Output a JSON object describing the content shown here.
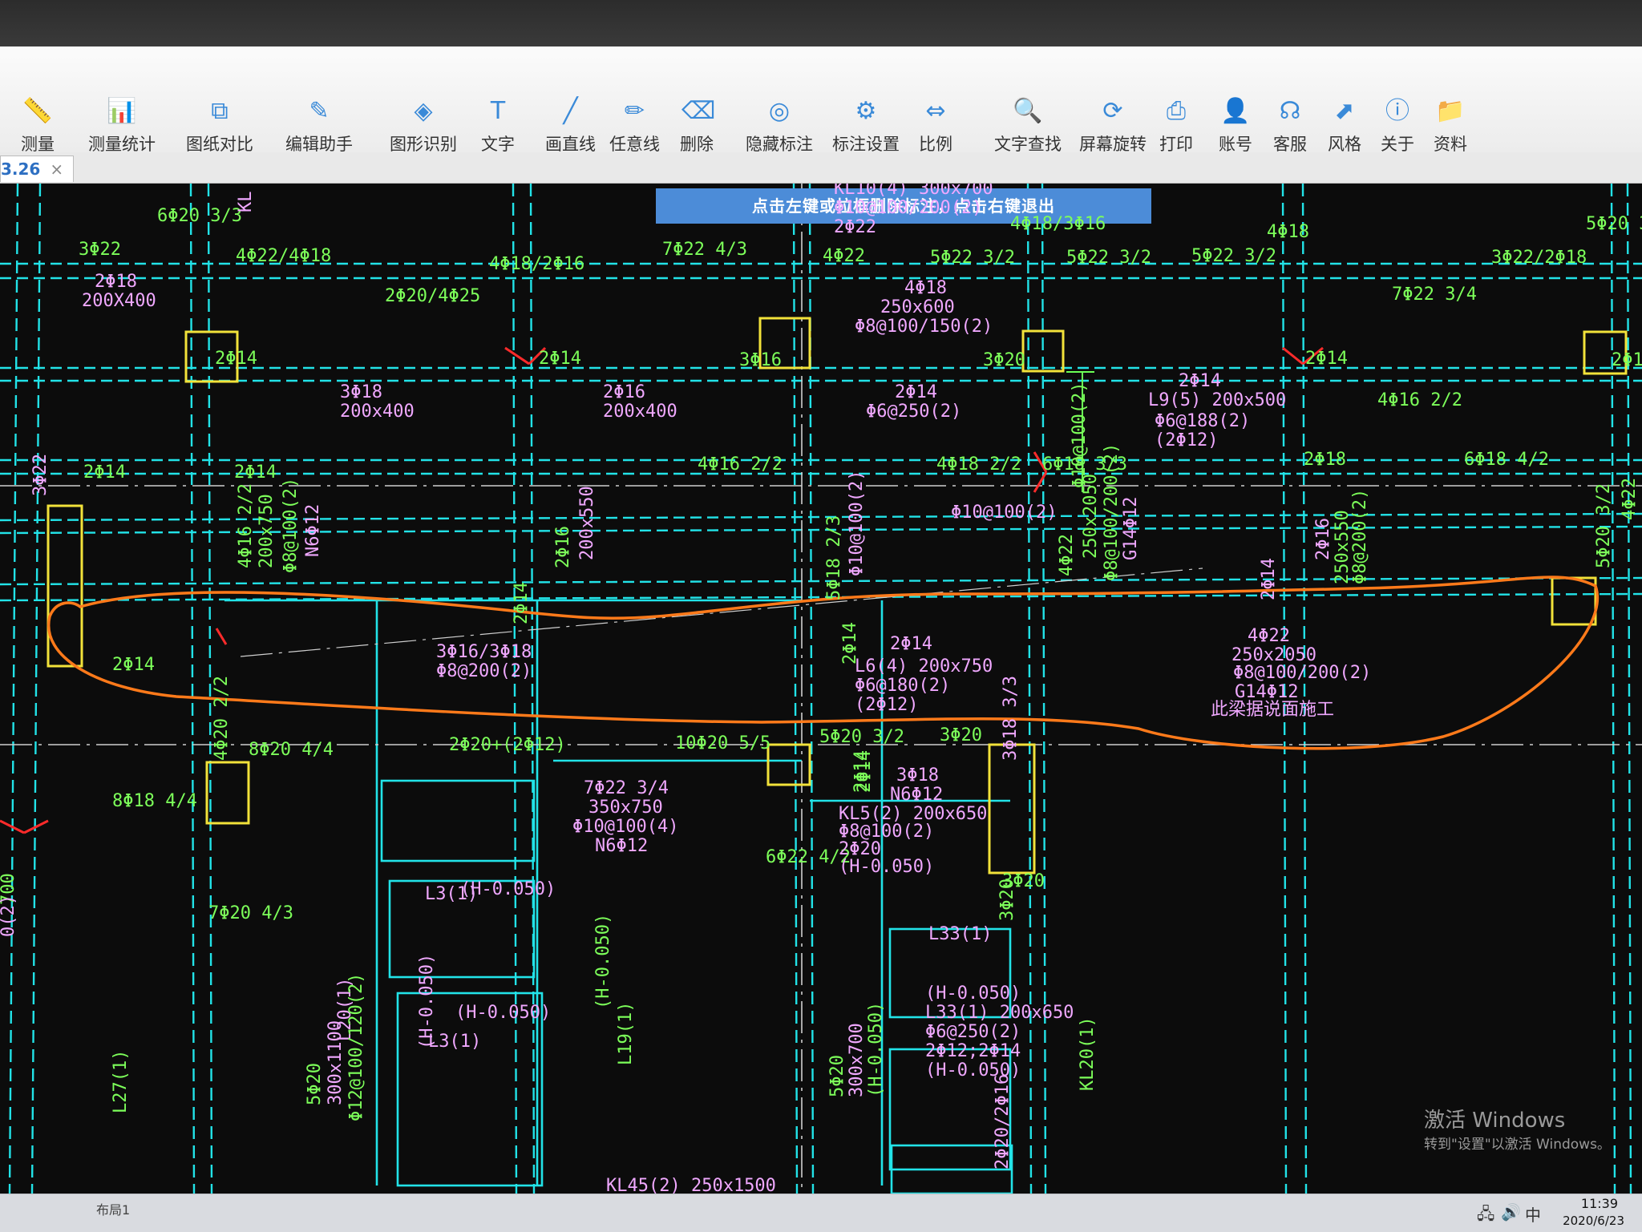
{
  "toolbar": {
    "items": [
      {
        "label": "测量",
        "icon": "ruler-icon",
        "glyph": "📏"
      },
      {
        "label": "测量统计",
        "icon": "measure-stats-icon",
        "glyph": "📊"
      },
      {
        "label": "图纸对比",
        "icon": "compare-drawings-icon",
        "glyph": "⧉"
      },
      {
        "label": "编辑助手",
        "icon": "edit-assistant-icon",
        "glyph": "✎"
      },
      {
        "label": "图形识别",
        "icon": "shape-recognition-icon",
        "glyph": "◈"
      },
      {
        "label": "文字",
        "icon": "text-icon",
        "glyph": "T"
      },
      {
        "label": "画直线",
        "icon": "line-icon",
        "glyph": "╱"
      },
      {
        "label": "任意线",
        "icon": "freehand-icon",
        "glyph": "✏"
      },
      {
        "label": "删除",
        "icon": "eraser-icon",
        "glyph": "⌫"
      },
      {
        "label": "隐藏标注",
        "icon": "hide-annotation-icon",
        "glyph": "◎"
      },
      {
        "label": "标注设置",
        "icon": "annotation-settings-icon",
        "glyph": "⚙"
      },
      {
        "label": "比例",
        "icon": "scale-icon",
        "glyph": "⇔"
      },
      {
        "label": "文字查找",
        "icon": "text-search-icon",
        "glyph": "🔍"
      },
      {
        "label": "屏幕旋转",
        "icon": "rotate-screen-icon",
        "glyph": "⟳"
      },
      {
        "label": "打印",
        "icon": "printer-icon",
        "glyph": "⎙"
      },
      {
        "label": "账号",
        "icon": "user-icon",
        "glyph": "👤"
      },
      {
        "label": "客服",
        "icon": "headset-icon",
        "glyph": "☊"
      },
      {
        "label": "风格",
        "icon": "style-icon",
        "glyph": "⬈"
      },
      {
        "label": "关于",
        "icon": "info-icon",
        "glyph": "ⓘ"
      },
      {
        "label": "资料",
        "icon": "documents-icon",
        "glyph": "📁"
      }
    ]
  },
  "file_tab": {
    "label": "3.26",
    "close": "×"
  },
  "canvas": {
    "hint": "点击左键或拉框删除标注，点击右键退出",
    "green_labels": [
      "3Φ22",
      "6Φ20 3/3",
      "4Φ22/4Φ18",
      "2Φ20/4Φ25",
      "4Φ18/2Φ16",
      "7Φ22 4/3",
      "5Φ22 3/2",
      "4Φ22",
      "5Φ22 3/2",
      "5Φ22 3/2",
      "4Φ18/3Φ16",
      "4Φ18",
      "3Φ22/2Φ18",
      "5Φ20 3/2",
      "7Φ22 3/4",
      "2Φ14",
      "2Φ14",
      "3Φ16",
      "3Φ20",
      "2Φ14",
      "2Φ14",
      "4Φ16 2/2",
      "2Φ14",
      "2Φ14",
      "4Φ16 2/2",
      "4Φ18 2/2",
      "6Φ18 3/3",
      "2Φ18",
      "6Φ18 4/2",
      "2Φ14",
      "8Φ20 4/4",
      "2Φ20+(2Φ12)",
      "10Φ20 5/5",
      "5Φ20 3/2",
      "3Φ20",
      "8Φ18 4/4",
      "6Φ22 4/2",
      "7Φ20 4/3",
      "3Φ20"
    ],
    "pink_labels": [
      "KL10(4) 300x700",
      "Φ10@100/200(2)",
      "2Φ22",
      "2Φ18",
      "200X400",
      "4Φ18",
      "250x600",
      "Φ8@100/150(2)",
      "3Φ18",
      "200x400",
      "2Φ16",
      "200x400",
      "2Φ14",
      "Φ6@250(2)",
      "Φ10@100(2)",
      "2Φ14",
      "L9(5) 200x500",
      "Φ6@188(2)",
      "(2Φ12)",
      "3Φ16/3Φ18",
      "Φ8@200(2)",
      "2Φ14",
      "L6(4) 200x750",
      "Φ6@180(2)",
      "(2Φ12)",
      "4Φ22",
      "250x2050",
      "Φ8@100/200(2)",
      "G14Φ12",
      "此梁据说面施工",
      "7Φ22 3/4",
      "350x750",
      "Φ10@100(4)",
      "N6Φ12",
      "3Φ18",
      "N6Φ12",
      "KL5(2) 200x650",
      "Φ8@100(2)",
      "2Φ20",
      "(H-0.050)",
      "L3(1)",
      "(H-0.050)",
      "(H-0.050)",
      "L3(1)",
      "L33(1)",
      "(H-0.050)",
      "L33(1) 200x650",
      "Φ6@250(2)",
      "2Φ12;2Φ14",
      "(H-0.050)",
      "KL45(2) 250x1500"
    ],
    "vertical_labels": [
      "KL",
      "200x750",
      "Φ8@100(2)",
      "N6Φ12",
      "250x2050",
      "Φ8@100/200(2)",
      "G14Φ12",
      "4Φ16 2/2",
      "2Φ16",
      "200x550",
      "2Φ14",
      "5Φ18 2/3",
      "Φ10@100(2)",
      "Φ10@100(2)",
      "4Φ22",
      "2Φ16",
      "250x550",
      "Φ8@200(2)",
      "2Φ14",
      "5Φ20 3/2",
      "4Φ22",
      "3Φ22",
      "4Φ20 2/2",
      "2Φ14",
      "L20(1)",
      "L27(1)",
      "L19(1)",
      "(H-0.050)",
      "(H-0.050)",
      "5Φ20",
      "300x700",
      "(H-0.050)",
      "5Φ20",
      "300x1100",
      "Φ12@100/120(2)",
      "KL20(1)",
      "3Φ18 3/3",
      "2Φ14",
      "3Φ20",
      "2Φ20/2Φ16",
      "2Φ14",
      "700",
      "0(2)"
    ],
    "line_colors": {
      "beam": "#22e3e8",
      "column": "#f2e23a",
      "grid": "#cfcfcf",
      "markup": "#ff7a1a",
      "red_mark": "#ff2b2b"
    }
  },
  "watermark": {
    "title": "激活 Windows",
    "subtitle": "转到\"设置\"以激活 Windows。"
  },
  "taskbar": {
    "layer_tab": "布局1",
    "ime": "中",
    "time": "11:39",
    "date": "2020/6/23"
  }
}
